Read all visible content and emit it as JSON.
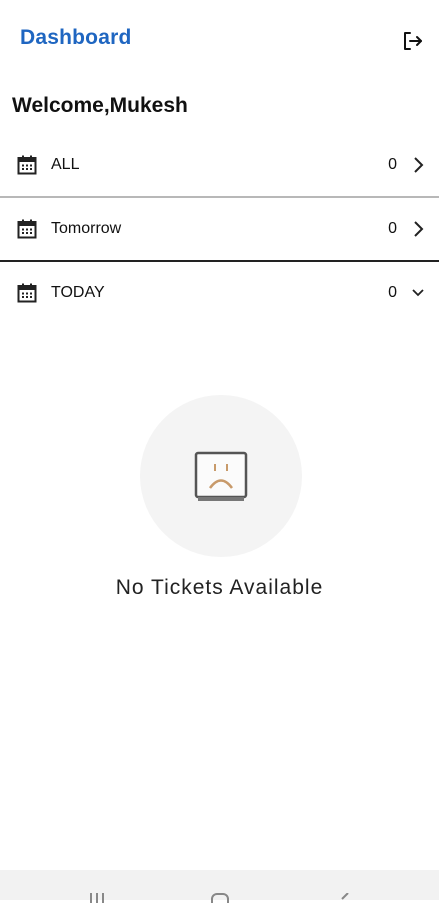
{
  "header": {
    "title": "Dashboard",
    "logout_icon": "logout-icon"
  },
  "welcome": "Welcome,Mukesh",
  "rows": [
    {
      "label": "ALL",
      "count": "0",
      "chevron": "chevron-right"
    },
    {
      "label": "Tomorrow",
      "count": "0",
      "chevron": "chevron-right"
    },
    {
      "label": "TODAY",
      "count": "0",
      "chevron": "chevron-down"
    }
  ],
  "empty_state": {
    "icon": "sad-ticket-icon",
    "message": "No Tickets Available"
  },
  "colors": {
    "accent": "#1f66c1",
    "sad_face": "#c89a6a"
  },
  "system_nav": [
    "recent-apps",
    "home",
    "back"
  ]
}
